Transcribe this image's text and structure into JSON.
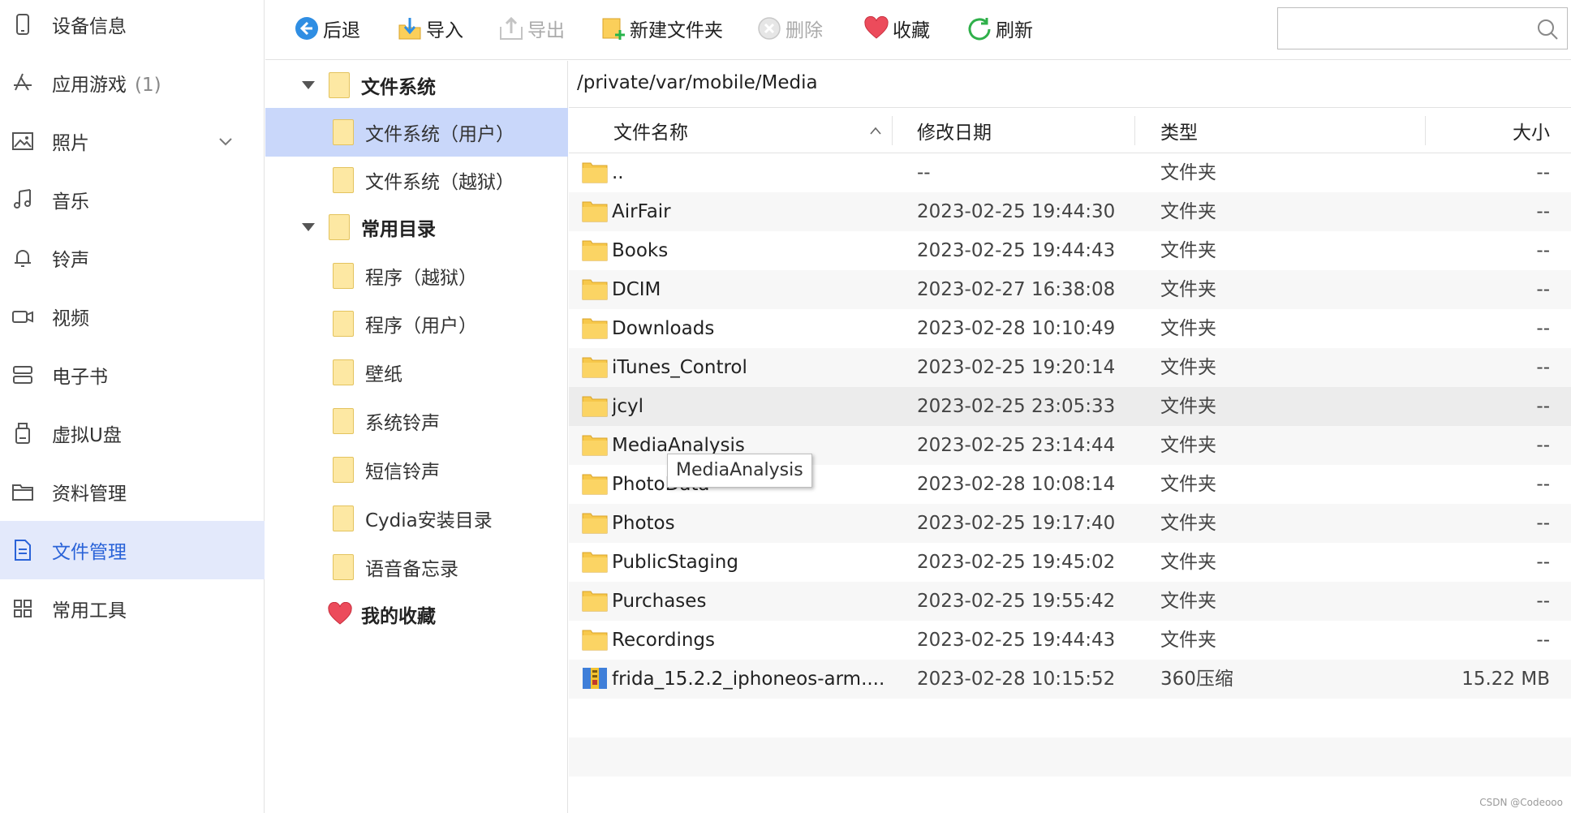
{
  "sidebar": {
    "items": [
      {
        "label": "设备信息",
        "icon": "phone-icon"
      },
      {
        "label": "应用游戏",
        "count": "(1)",
        "icon": "app-store-icon"
      },
      {
        "label": "照片",
        "icon": "image-icon"
      },
      {
        "label": "音乐",
        "icon": "music-note-icon"
      },
      {
        "label": "铃声",
        "icon": "bell-icon"
      },
      {
        "label": "视频",
        "icon": "video-camera-icon"
      },
      {
        "label": "电子书",
        "icon": "book-icon"
      },
      {
        "label": "虚拟U盘",
        "icon": "usb-drive-icon"
      },
      {
        "label": "资料管理",
        "icon": "folder-outline-icon"
      },
      {
        "label": "文件管理",
        "icon": "document-icon",
        "active": true
      },
      {
        "label": "常用工具",
        "icon": "grid-icon"
      }
    ],
    "active_color": "#2a63d8"
  },
  "toolbar": {
    "back": "后退",
    "import": "导入",
    "export": "导出",
    "new_folder": "新建文件夹",
    "delete": "删除",
    "favorite": "收藏",
    "refresh": "刷新",
    "search_placeholder": ""
  },
  "tree": {
    "items": [
      {
        "label": "文件系统",
        "bold": true
      },
      {
        "label": "文件系统（用户）",
        "selected": true
      },
      {
        "label": "文件系统（越狱）"
      },
      {
        "label": "常用目录",
        "bold": true
      },
      {
        "label": "程序（越狱）"
      },
      {
        "label": "程序（用户）"
      },
      {
        "label": "壁纸"
      },
      {
        "label": "系统铃声"
      },
      {
        "label": "短信铃声"
      },
      {
        "label": "Cydia安装目录"
      },
      {
        "label": "语音备忘录"
      },
      {
        "label": "我的收藏",
        "bold": true
      }
    ]
  },
  "path": "/private/var/mobile/Media",
  "columns": {
    "name": "文件名称",
    "modified": "修改日期",
    "type": "类型",
    "size": "大小"
  },
  "files": [
    {
      "name": "..",
      "date": "--",
      "type": "文件夹",
      "size": "--"
    },
    {
      "name": "AirFair",
      "date": "2023-02-25 19:44:30",
      "type": "文件夹",
      "size": "--"
    },
    {
      "name": "Books",
      "date": "2023-02-25 19:44:43",
      "type": "文件夹",
      "size": "--"
    },
    {
      "name": "DCIM",
      "date": "2023-02-27 16:38:08",
      "type": "文件夹",
      "size": "--"
    },
    {
      "name": "Downloads",
      "date": "2023-02-28 10:10:49",
      "type": "文件夹",
      "size": "--"
    },
    {
      "name": "iTunes_Control",
      "date": "2023-02-25 19:20:14",
      "type": "文件夹",
      "size": "--"
    },
    {
      "name": "jcyl",
      "date": "2023-02-25 23:05:33",
      "type": "文件夹",
      "size": "--"
    },
    {
      "name": "MediaAnalysis",
      "date": "2023-02-25 23:14:44",
      "type": "文件夹",
      "size": "--"
    },
    {
      "name": "PhotoData",
      "date": "2023-02-28 10:08:14",
      "type": "文件夹",
      "size": "--"
    },
    {
      "name": "Photos",
      "date": "2023-02-25 19:17:40",
      "type": "文件夹",
      "size": "--"
    },
    {
      "name": "PublicStaging",
      "date": "2023-02-25 19:45:02",
      "type": "文件夹",
      "size": "--"
    },
    {
      "name": "Purchases",
      "date": "2023-02-25 19:55:42",
      "type": "文件夹",
      "size": "--"
    },
    {
      "name": "Recordings",
      "date": "2023-02-25 19:44:43",
      "type": "文件夹",
      "size": "--"
    },
    {
      "name": "frida_15.2.2_iphoneos-arm....",
      "date": "2023-02-28 10:15:52",
      "type": "360压缩",
      "size": "15.22 MB",
      "archive": true
    }
  ],
  "tooltip": "MediaAnalysis",
  "watermark": "CSDN @Codeooo"
}
